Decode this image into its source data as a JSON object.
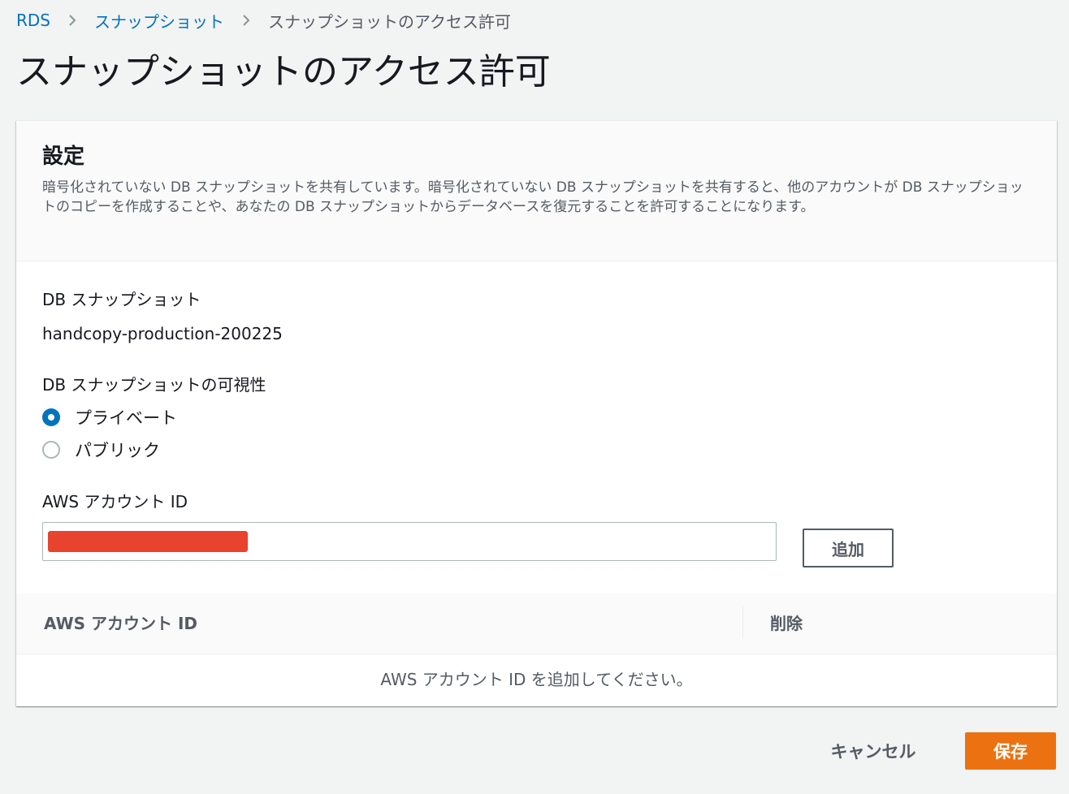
{
  "breadcrumb": {
    "items": [
      "RDS",
      "スナップショット",
      "スナップショットのアクセス許可"
    ],
    "separator_icon": "chevron-right-icon"
  },
  "page": {
    "title": "スナップショットのアクセス許可"
  },
  "settings": {
    "title": "設定",
    "description": "暗号化されていない DB スナップショットを共有しています。暗号化されていない DB スナップショットを共有すると、他のアカウントが DB スナップショットのコピーを作成することや、あなたの DB スナップショットからデータベースを復元することを許可することになります。",
    "snapshot_label": "DB スナップショット",
    "snapshot_value": "handcopy-production-200225",
    "visibility_label": "DB スナップショットの可視性",
    "visibility_options": [
      {
        "label": "プライベート",
        "checked": true
      },
      {
        "label": "パブリック",
        "checked": false
      }
    ],
    "account_label": "AWS アカウント ID",
    "account_input_value_redacted": true,
    "add_button": "追加"
  },
  "accounts_table": {
    "columns": [
      "AWS アカウント ID",
      "削除"
    ],
    "rows": [],
    "empty_message": "AWS アカウント ID を追加してください。"
  },
  "footer": {
    "cancel_button": "キャンセル",
    "save_button": "保存"
  },
  "colors": {
    "link": "#0073bb",
    "primary_button": "#ec7211",
    "background": "#f2f3f3",
    "redaction": "#e8432e"
  }
}
